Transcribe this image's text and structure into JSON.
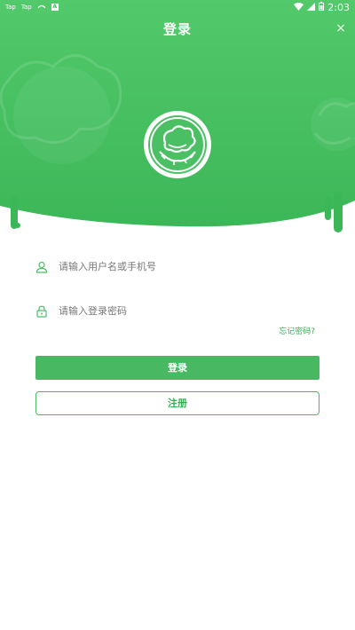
{
  "status_bar": {
    "left_items": [
      "Tap",
      "Tap"
    ],
    "time": "2:03"
  },
  "header": {
    "title": "登录",
    "close_glyph": "×",
    "brand_color": "#4cc465"
  },
  "form": {
    "username_placeholder": "请输入用户名或手机号",
    "password_placeholder": "请输入登录密码",
    "forgot_label": "忘记密码?",
    "login_label": "登录",
    "register_label": "注册"
  },
  "icons": {
    "user": "user-icon",
    "lock": "lock-icon",
    "close": "close-icon",
    "logo": "cotton-logo-icon"
  }
}
